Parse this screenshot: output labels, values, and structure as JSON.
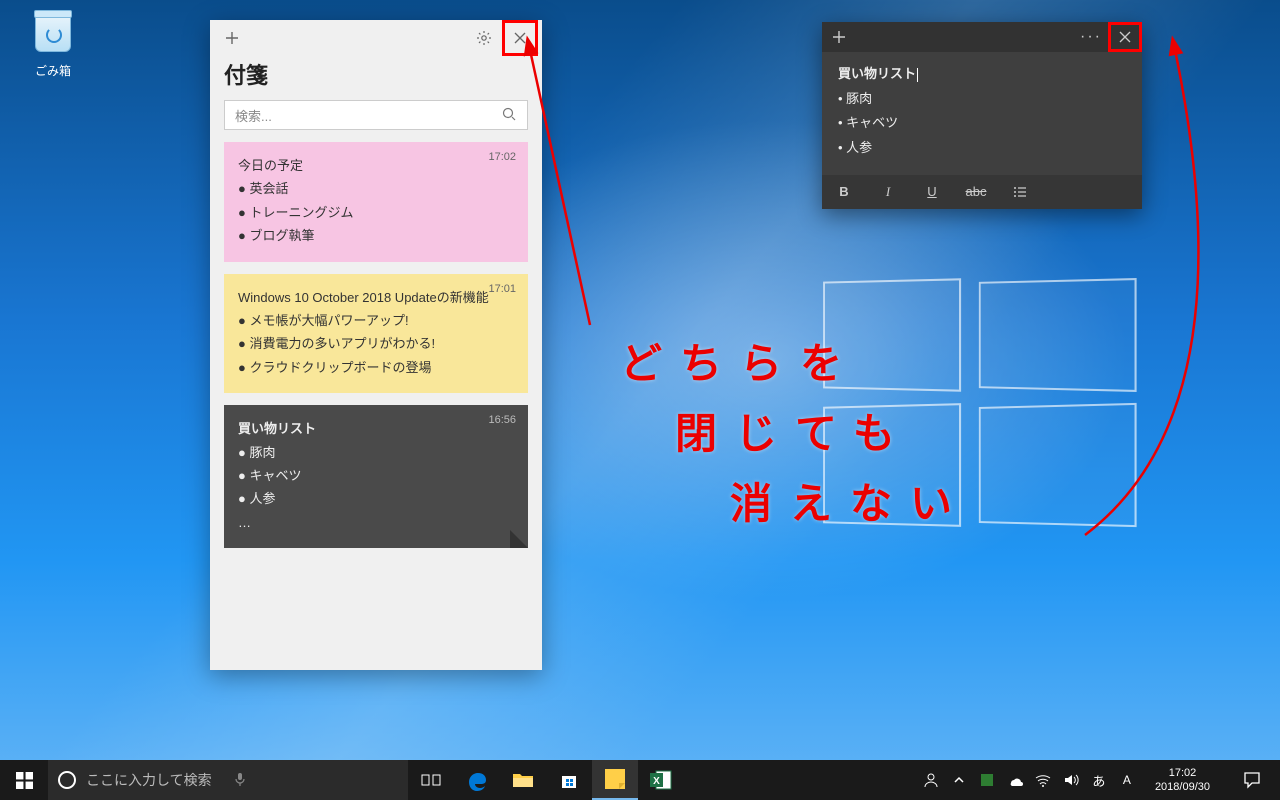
{
  "desktop": {
    "recycle_bin": "ごみ箱"
  },
  "sticky_notes": {
    "title": "付箋",
    "search_placeholder": "検索...",
    "cards": [
      {
        "time": "17:02",
        "title": "今日の予定",
        "lines": [
          "● 英会話",
          "● トレーニングジム",
          "● ブログ執筆"
        ]
      },
      {
        "time": "17:01",
        "title": "Windows 10 October 2018 Updateの新機能",
        "lines": [
          "● メモ帳が大幅パワーアップ!",
          "● 消費電力の多いアプリがわかる!",
          "● クラウドクリップボードの登場"
        ]
      },
      {
        "time": "16:56",
        "title": "買い物リスト",
        "lines": [
          "● 豚肉",
          "● キャベツ",
          "● 人参",
          "…"
        ]
      }
    ]
  },
  "note_popup": {
    "title": "買い物リスト",
    "lines": [
      "• 豚肉",
      "• キャベツ",
      "• 人参"
    ],
    "fmt": {
      "bold": "B",
      "italic": "I",
      "underline": "U",
      "strike": "abc"
    }
  },
  "annotation": {
    "l1": "どちらを",
    "l2": "閉じても",
    "l3": "消えない"
  },
  "taskbar": {
    "search_placeholder": "ここに入力して検索",
    "clock_time": "17:02",
    "clock_date": "2018/09/30"
  }
}
